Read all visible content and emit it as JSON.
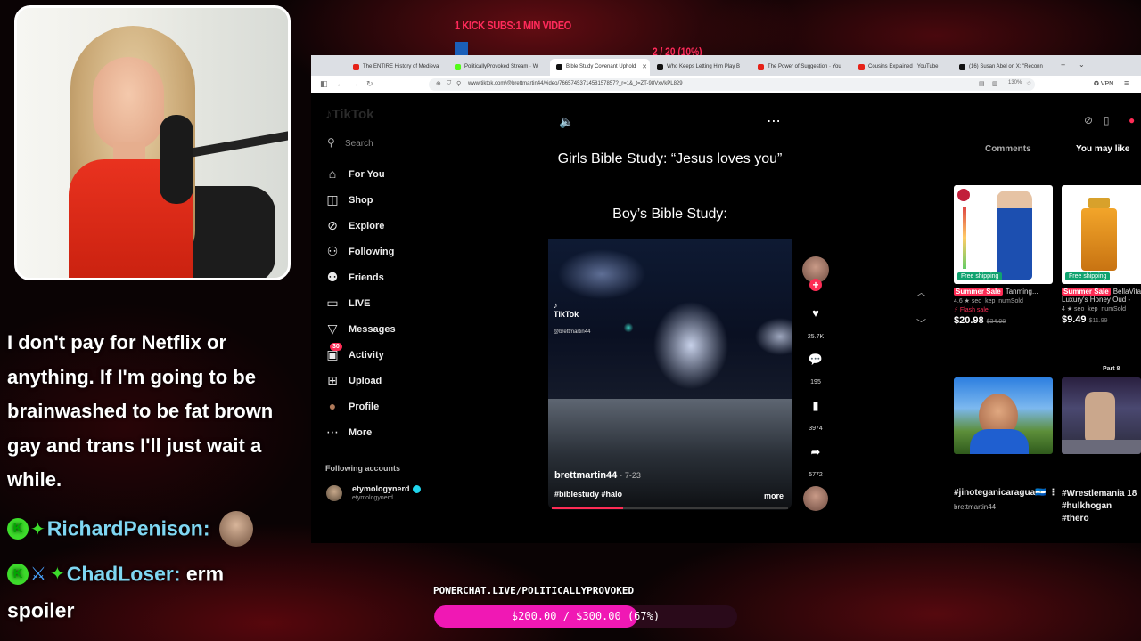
{
  "overlay": {
    "kick_label": "1 KICK SUBS:1 MIN VIDEO",
    "sub_count": "2 / 20 (10%)",
    "sub_progress": 0.1,
    "powerchat_url": "POWERCHAT.LIVE/POLITICALLYPROVOKED",
    "goal_text": "$200.00 / $300.00 (67%)",
    "goal_progress": 0.67
  },
  "chat": {
    "message": "I don't pay for Netflix or anything. If I'm going to be brainwashed to be fat brown gay and trans I'll just wait a while.",
    "lines": [
      {
        "badge": "K",
        "user": "RichardPenison:",
        "text": ""
      },
      {
        "badge": "K",
        "user": "ChadLoser:",
        "text": "erm",
        "text2": "spoiler"
      }
    ]
  },
  "browser": {
    "tabs": [
      {
        "title": "The ENTIRE History of Medieva",
        "color": "#e62117"
      },
      {
        "title": "PoliticallyProvoked Stream · W",
        "color": "#53fc18"
      },
      {
        "title": "Bible Study Covenant Uphold",
        "color": "#111111"
      },
      {
        "title": "Who Keeps Letting Him Play B",
        "color": "#111111"
      },
      {
        "title": "The Power of Suggestion · You",
        "color": "#e62117"
      },
      {
        "title": "Cousins Explained · YouTube",
        "color": "#e62117"
      },
      {
        "title": "(16) Susan Abel on X: \"Reconn",
        "color": "#111111"
      }
    ],
    "url": "www.tiktok.com/@brettmartin44/video/7665745371458157857?_r=1&_t=ZT-98VxVkPL829",
    "zoom": "130%",
    "vpn": "VPN"
  },
  "tiktok": {
    "logo": "TikTok",
    "search_placeholder": "Search",
    "nav": [
      {
        "label": "For You",
        "icon": "home-icon",
        "glyph": "⌂"
      },
      {
        "label": "Shop",
        "icon": "shopping-bag-icon",
        "glyph": "◫"
      },
      {
        "label": "Explore",
        "icon": "compass-icon",
        "glyph": "⊘"
      },
      {
        "label": "Following",
        "icon": "person-plus-icon",
        "glyph": "⚇"
      },
      {
        "label": "Friends",
        "icon": "friends-icon",
        "glyph": "⚉"
      },
      {
        "label": "LIVE",
        "icon": "live-icon",
        "glyph": "▭"
      },
      {
        "label": "Messages",
        "icon": "paper-plane-icon",
        "glyph": "▽"
      },
      {
        "label": "Activity",
        "icon": "inbox-icon",
        "glyph": "▣",
        "badge": "30"
      },
      {
        "label": "Upload",
        "icon": "upload-plus-icon",
        "glyph": "⊞"
      },
      {
        "label": "Profile",
        "icon": "avatar-icon",
        "glyph": "●"
      },
      {
        "label": "More",
        "icon": "more-dots-icon",
        "glyph": "⋯"
      }
    ],
    "following_header": "Following accounts",
    "following": [
      {
        "name": "etymologynerd",
        "handle": "etymologynerd"
      }
    ],
    "video": {
      "caption_line1": "Girls Bible Study: “Jesus loves you”",
      "caption_line2": "Boy’s Bible Study:",
      "watermark": "TikTok",
      "watermark_handle": "@brettmartin44",
      "author": "brettmartin44",
      "date": "· 7-23",
      "tags": "#biblestudy #halo",
      "more": "more",
      "progress": 0.3
    },
    "actions": {
      "likes": "25.7K",
      "comments": "195",
      "saves": "3974",
      "shares": "5772"
    },
    "right_tabs": {
      "comments": "Comments",
      "you_may_like": "You may like"
    },
    "products": [
      {
        "badge": "Free shipping",
        "sale": "Summer Sale",
        "title": "Tanming...",
        "rating": "4.6 ★  seo_kep_numSold",
        "flash": "⚡ Flash sale",
        "price": "$20.98",
        "old_price": "$34.98"
      },
      {
        "badge": "Free shipping",
        "sale": "Summer Sale",
        "title": "BellaVita",
        "title2": "Luxury's Honey Oud -",
        "rating": "4 ★  seo_kep_numSold",
        "price": "$9.49",
        "old_price": "$11.99"
      }
    ],
    "recs": [
      {
        "title": "#jinoteganicaragua🇳🇮 ⋮",
        "user": "brettmartin44"
      },
      {
        "title": "#Wrestlemania 18 #hulkhogan #thero",
        "user": "",
        "part": "Part 8"
      }
    ]
  }
}
